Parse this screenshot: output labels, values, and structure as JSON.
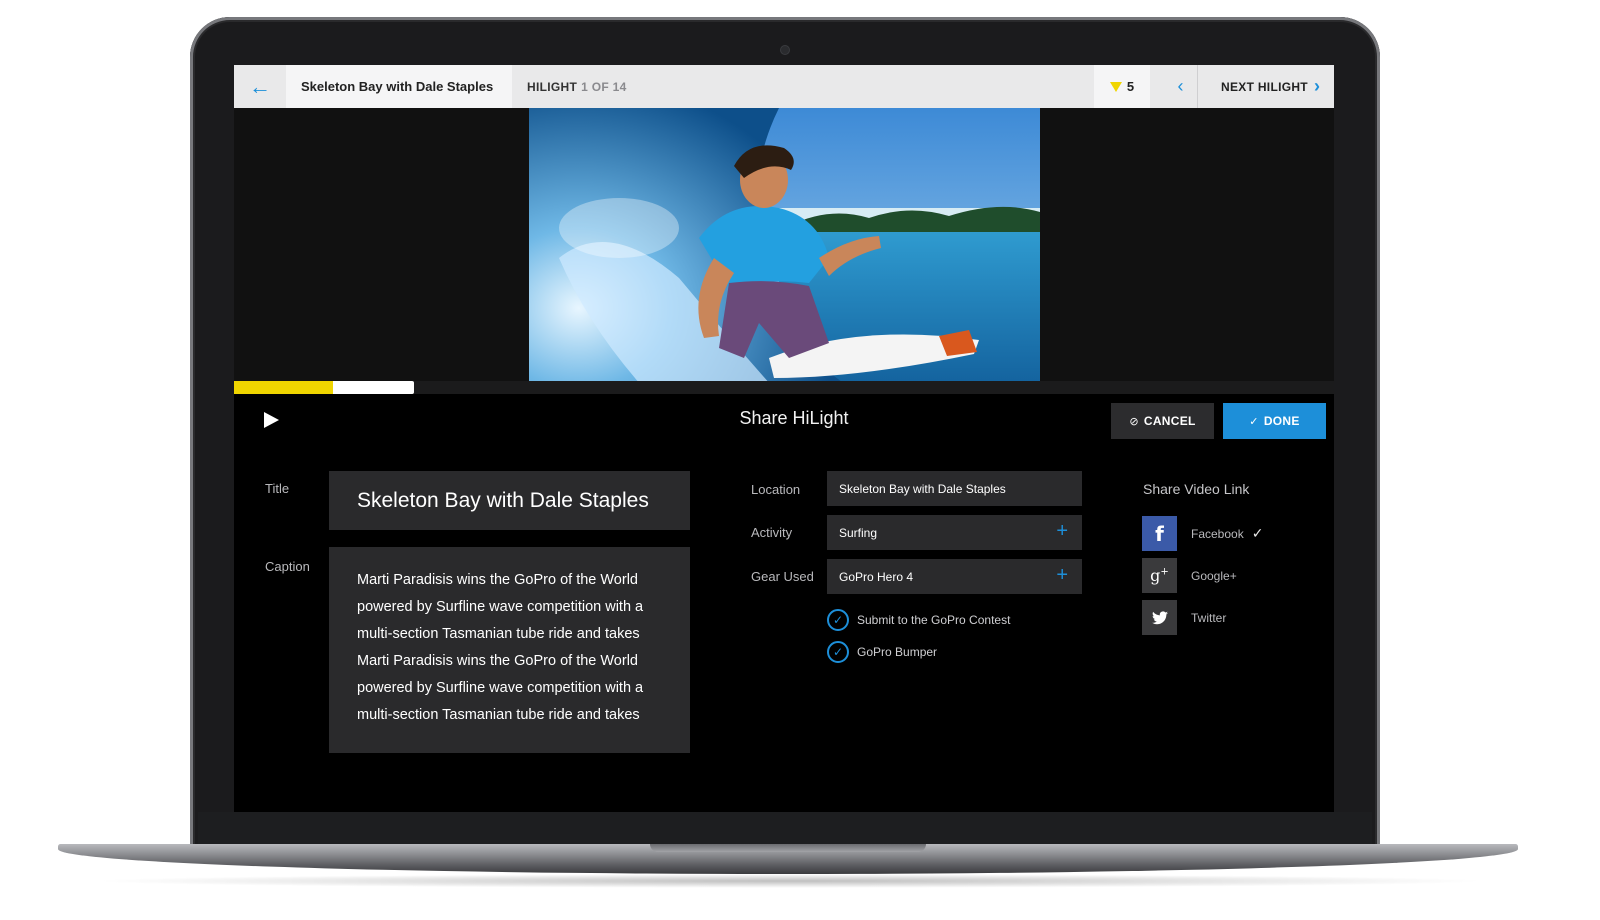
{
  "topbar": {
    "title": "Skeleton Bay with Dale Staples",
    "hilight_label": "HILIGHT",
    "hilight_position": "1 OF 14",
    "count": "5",
    "next_label": "NEXT HILIGHT"
  },
  "player": {
    "played_fraction": 0.09,
    "buffered_fraction": 0.164
  },
  "controls": {
    "share_title": "Share HiLight",
    "cancel_label": "CANCEL",
    "done_label": "DONE"
  },
  "form": {
    "title_label": "Title",
    "title_value": "Skeleton Bay with Dale Staples",
    "caption_label": "Caption",
    "caption_lines": [
      "Marti Paradisis wins the GoPro of the World",
      "powered by Surfline wave competition with a",
      "multi-section Tasmanian tube ride and takes",
      "Marti Paradisis wins the GoPro of the World",
      "powered by Surfline wave competition with a",
      "multi-section Tasmanian tube ride and takes"
    ],
    "location_label": "Location",
    "location_value": "Skeleton Bay with Dale Staples",
    "activity_label": "Activity",
    "activity_value": "Surfing",
    "gear_label": "Gear Used",
    "gear_value": "GoPro Hero 4",
    "checks": [
      {
        "label": "Submit to the GoPro Contest",
        "checked": true
      },
      {
        "label": "GoPro Bumper",
        "checked": true
      }
    ]
  },
  "share": {
    "heading": "Share Video Link",
    "networks": [
      {
        "name": "Facebook",
        "icon": "facebook-icon",
        "color": "#3b5aa8",
        "selected": true
      },
      {
        "name": "Google+",
        "icon": "google-plus-icon",
        "color": "#3a3a3c",
        "selected": false
      },
      {
        "name": "Twitter",
        "icon": "twitter-icon",
        "color": "#3a3a3c",
        "selected": false
      }
    ]
  },
  "colors": {
    "accent": "#1d8fd9",
    "progress": "#f0d500",
    "field_bg": "#2a2a2c"
  }
}
